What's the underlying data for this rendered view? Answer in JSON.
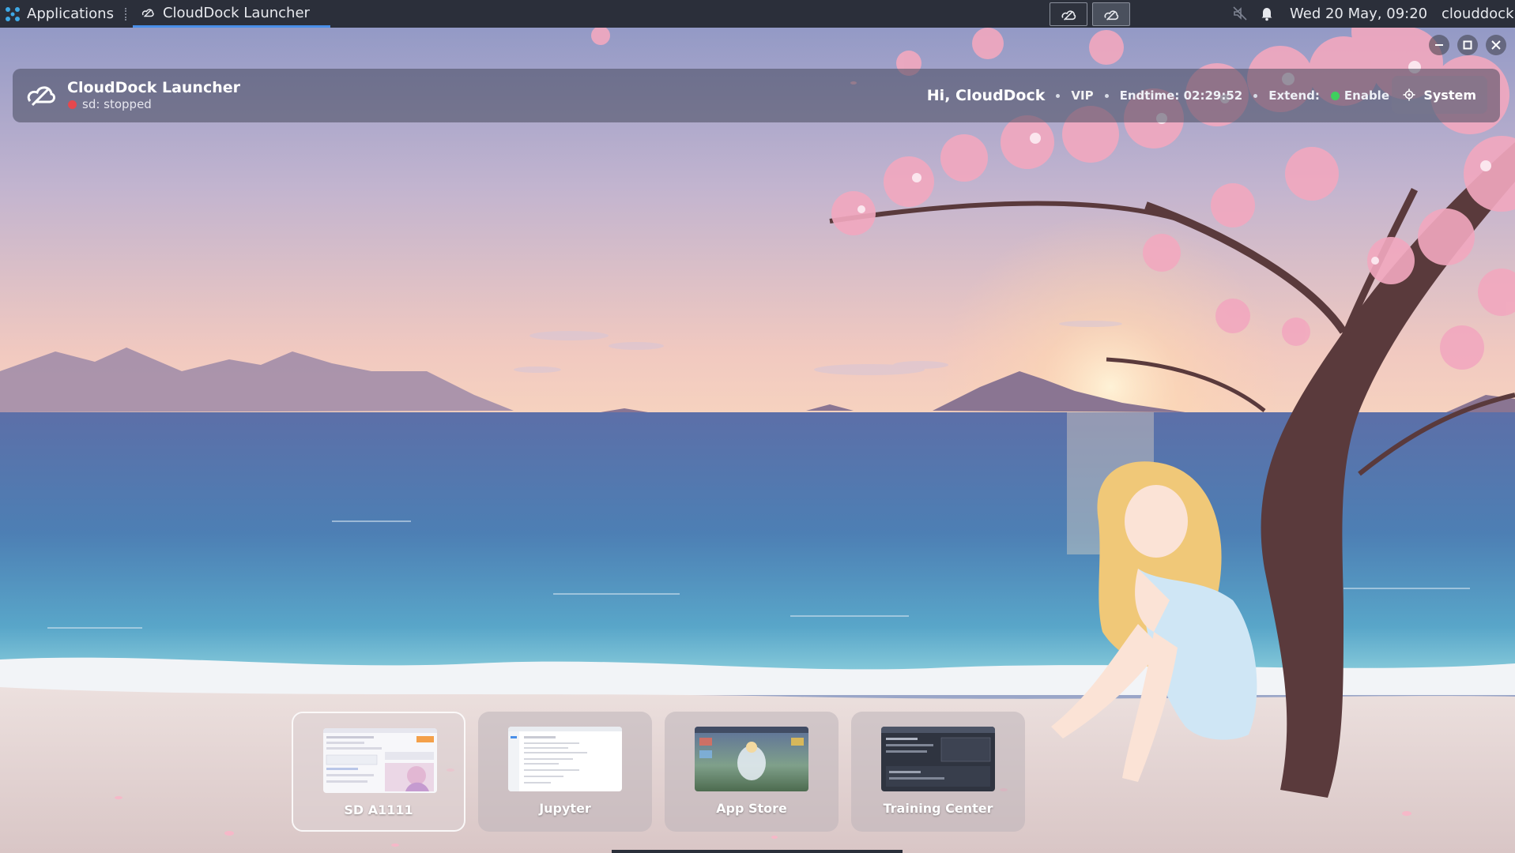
{
  "taskbar": {
    "applications_label": "Applications",
    "active_task_label": "CloudDock Launcher",
    "clock": "Wed 20 May, 09:20",
    "user": "clouddock"
  },
  "header": {
    "title": "CloudDock Launcher",
    "status": "sd: stopped",
    "greeting": "Hi, CloudDock",
    "tier": "VIP",
    "endtime": "Endtime: 02:29:52",
    "extend_label": "Extend:",
    "extend_value": "Enable",
    "system_label": "System"
  },
  "dock": {
    "items": [
      {
        "label": "SD A1111"
      },
      {
        "label": "Jupyter"
      },
      {
        "label": "App Store"
      },
      {
        "label": "Training Center"
      }
    ]
  },
  "colors": {
    "status_stopped": "#e5484d",
    "status_enabled": "#3fcf5e",
    "taskbar_bg": "#2b2f3a",
    "accent": "#4a8fe8"
  },
  "icons": [
    "apps-grid-icon",
    "clouddock-logo-icon",
    "mute-icon",
    "bell-icon",
    "minimize-icon",
    "maximize-icon",
    "close-icon",
    "gear-icon"
  ]
}
